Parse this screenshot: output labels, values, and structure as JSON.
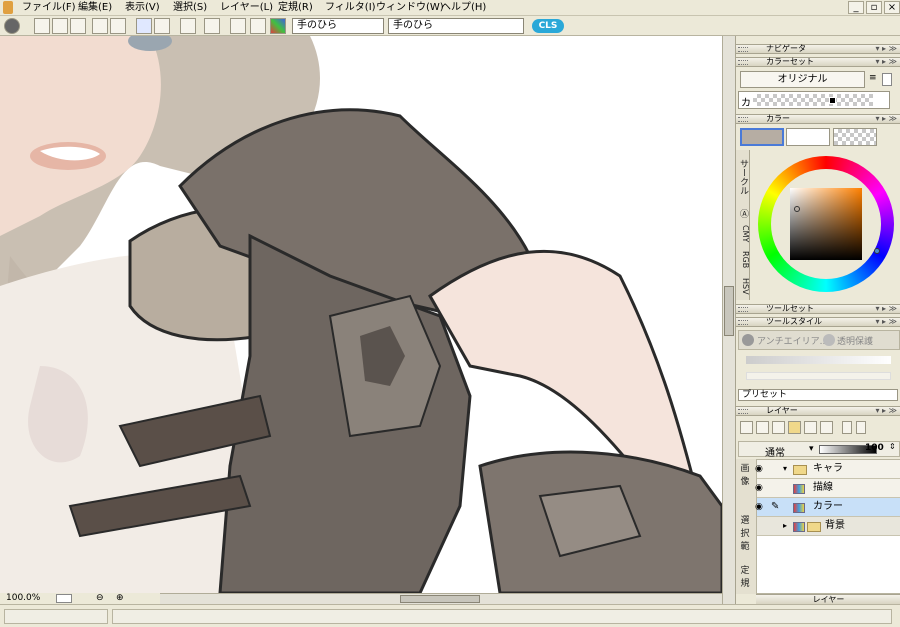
{
  "menubar": {
    "items": [
      "ファイル(F)",
      "編集(E)",
      "表示(V)",
      "選択(S)",
      "レイヤー(L)",
      "定規(R)",
      "フィルタ(I)",
      "ウィンドウ(W)",
      "ヘルプ(H)"
    ],
    "window_buttons": [
      "_",
      "▫",
      "×"
    ]
  },
  "toolbar": {
    "brush_name_1": "手のひら",
    "brush_name_2": "手のひら",
    "logo": "CLS"
  },
  "status": {
    "zoom": "100.0%"
  },
  "panels": {
    "navigator": "ナビゲータ",
    "color_set": "カラーセット",
    "color_set_value": "オリジナル",
    "color_set_row_label": "カ",
    "color": "カラー",
    "color_tabs": [
      "サークル",
      "Ⓐ",
      "CMY",
      "RGB",
      "HSV"
    ],
    "tool_set": "ツールセット",
    "tool_style": "ツールスタイル",
    "antialias": "アンチエイリア..",
    "transparent_protect": "透明保護",
    "preset": "プリセット",
    "layer": "レイヤー",
    "blend_mode": "通常",
    "opacity": "100",
    "layer_side_tabs": [
      "画像",
      "選択範",
      "定規"
    ],
    "layers": [
      {
        "name": "キャラ",
        "type": "folder"
      },
      {
        "name": "描線",
        "type": "layer"
      },
      {
        "name": "カラー",
        "type": "layer"
      },
      {
        "name": "背景",
        "type": "folder"
      }
    ],
    "layer_footer": "レイヤー"
  },
  "colors": {
    "main_color": "#b6ada3",
    "sub_color": "#ffffff",
    "selected_layer_bg": "#c8e0f8"
  }
}
